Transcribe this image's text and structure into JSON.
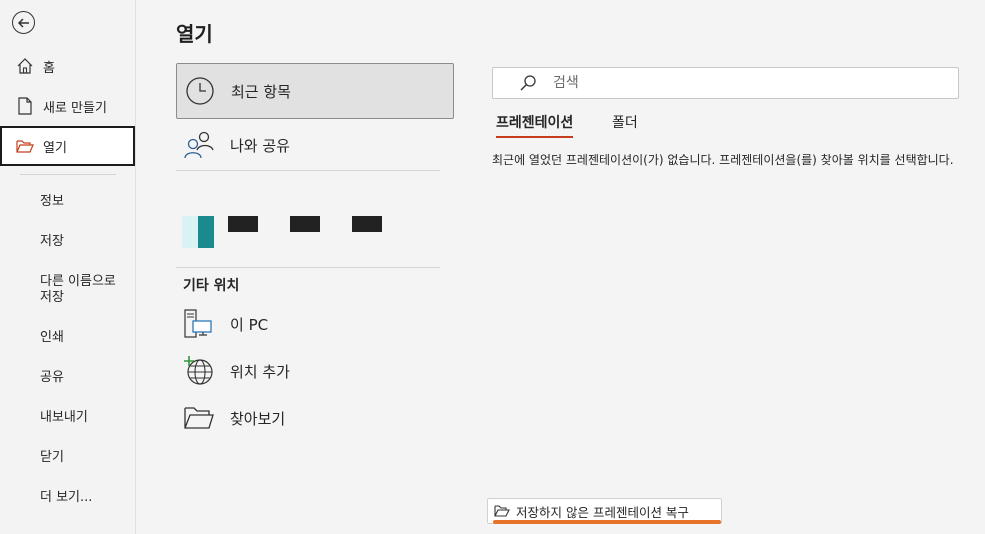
{
  "sidebar": {
    "back_label": "",
    "items": [
      {
        "label": "홈"
      },
      {
        "label": "새로 만들기"
      },
      {
        "label": "열기"
      }
    ],
    "sub_items": [
      {
        "label": "정보"
      },
      {
        "label": "저장"
      },
      {
        "label": "다른 이름으로 저장"
      },
      {
        "label": "인쇄"
      },
      {
        "label": "공유"
      },
      {
        "label": "내보내기"
      },
      {
        "label": "닫기"
      },
      {
        "label": "더 보기..."
      }
    ]
  },
  "main": {
    "title": "열기",
    "locations": [
      {
        "label": "최근 항목",
        "icon": "clock-icon"
      },
      {
        "label": "나와 공유",
        "icon": "people-icon"
      }
    ],
    "other_heading": "기타 위치",
    "other_locations": [
      {
        "label": "이 PC",
        "icon": "computer-icon"
      },
      {
        "label": "위치 추가",
        "icon": "globe-add-icon"
      },
      {
        "label": "찾아보기",
        "icon": "folder-icon"
      }
    ],
    "search": {
      "placeholder": "검색"
    },
    "tabs": [
      {
        "label": "프레젠테이션"
      },
      {
        "label": "폴더"
      }
    ],
    "empty_message": "최근에 열었던 프레젠테이션이(가) 없습니다. 프레젠테이션을(를) 찾아볼 위치를 선택합니다.",
    "recover_button": "저장하지 않은 프레젠테이션 복구"
  },
  "colors": {
    "accent": "#c43e1c",
    "recover_highlight": "#e8742a",
    "tile_teal": "#1a8a8f"
  }
}
